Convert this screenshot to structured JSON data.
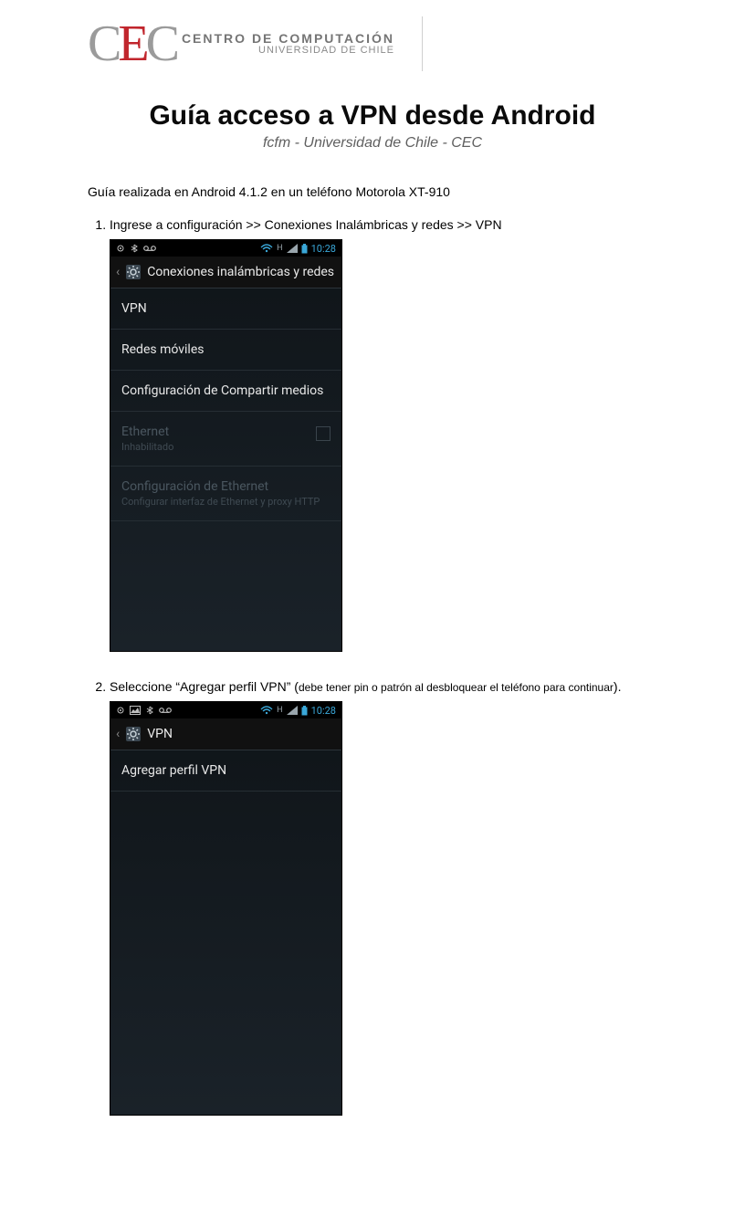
{
  "logo": {
    "mark_c1": "C",
    "mark_e": "E",
    "mark_c2": "C",
    "line1": "CENTRO DE COMPUTACIÓN",
    "line2": "UNIVERSIDAD DE CHILE"
  },
  "title": "Guía acceso a VPN desde Android",
  "subtitle": "fcfm - Universidad de Chile - CEC",
  "intro": "Guía realizada en Android  4.1.2 en un teléfono Motorola XT-910",
  "steps": {
    "s1": {
      "num": "1.",
      "text": "Ingrese a configuración >> Conexiones Inalámbricas y redes >> VPN"
    },
    "s2": {
      "num": "2.",
      "text_a": "Seleccione “Agregar perfil VPN”  (",
      "text_small": "debe tener  pin o patrón al desbloquear el teléfono para continuar",
      "text_b": ")."
    }
  },
  "shot1": {
    "time": "10:28",
    "sb_h": "H",
    "sb_voicemail": "QD",
    "titlebar": "Conexiones inalámbricas y redes",
    "items": {
      "vpn": "VPN",
      "redes": "Redes móviles",
      "comp": "Configuración de Compartir medios",
      "eth": "Ethernet",
      "eth_sub": "Inhabilitado",
      "ethcfg": "Configuración de Ethernet",
      "ethcfg_sub": "Configurar interfaz de Ethernet y proxy HTTP"
    }
  },
  "shot2": {
    "time": "10:28",
    "sb_h": "H",
    "titlebar": "VPN",
    "item": "Agregar perfil VPN"
  }
}
